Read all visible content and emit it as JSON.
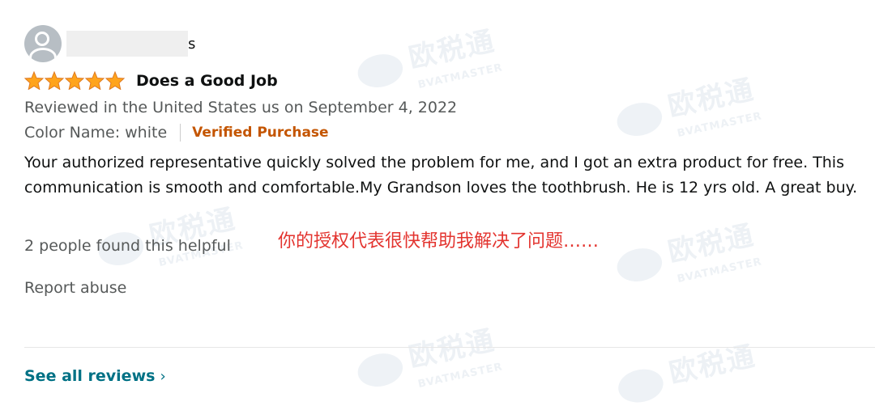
{
  "reviewer": {
    "name_visible_suffix": "s"
  },
  "review": {
    "rating": 5,
    "title": "Does a Good Job",
    "meta": "Reviewed in the United States us on September 4, 2022",
    "variant_label": "Color Name: white",
    "verified_label": "Verified Purchase",
    "body": "Your authorized representative quickly solved the problem for me, and I got an extra product for free. This communication is smooth and comfortable.My Grandson loves the toothbrush. He is 12 yrs old. A great buy.",
    "helpful": "2 people found this helpful",
    "report": "Report abuse"
  },
  "annotation": {
    "translation": "你的授权代表很快帮助我解决了问题……"
  },
  "footer": {
    "see_all": "See all reviews",
    "chevron": "›"
  },
  "watermark": {
    "brand_cn": "欧税通",
    "brand_en": "BVATMASTER"
  },
  "colors": {
    "star": "#ffa41c",
    "link": "#007185",
    "verified": "#c45500",
    "translation": "#e3342f"
  }
}
